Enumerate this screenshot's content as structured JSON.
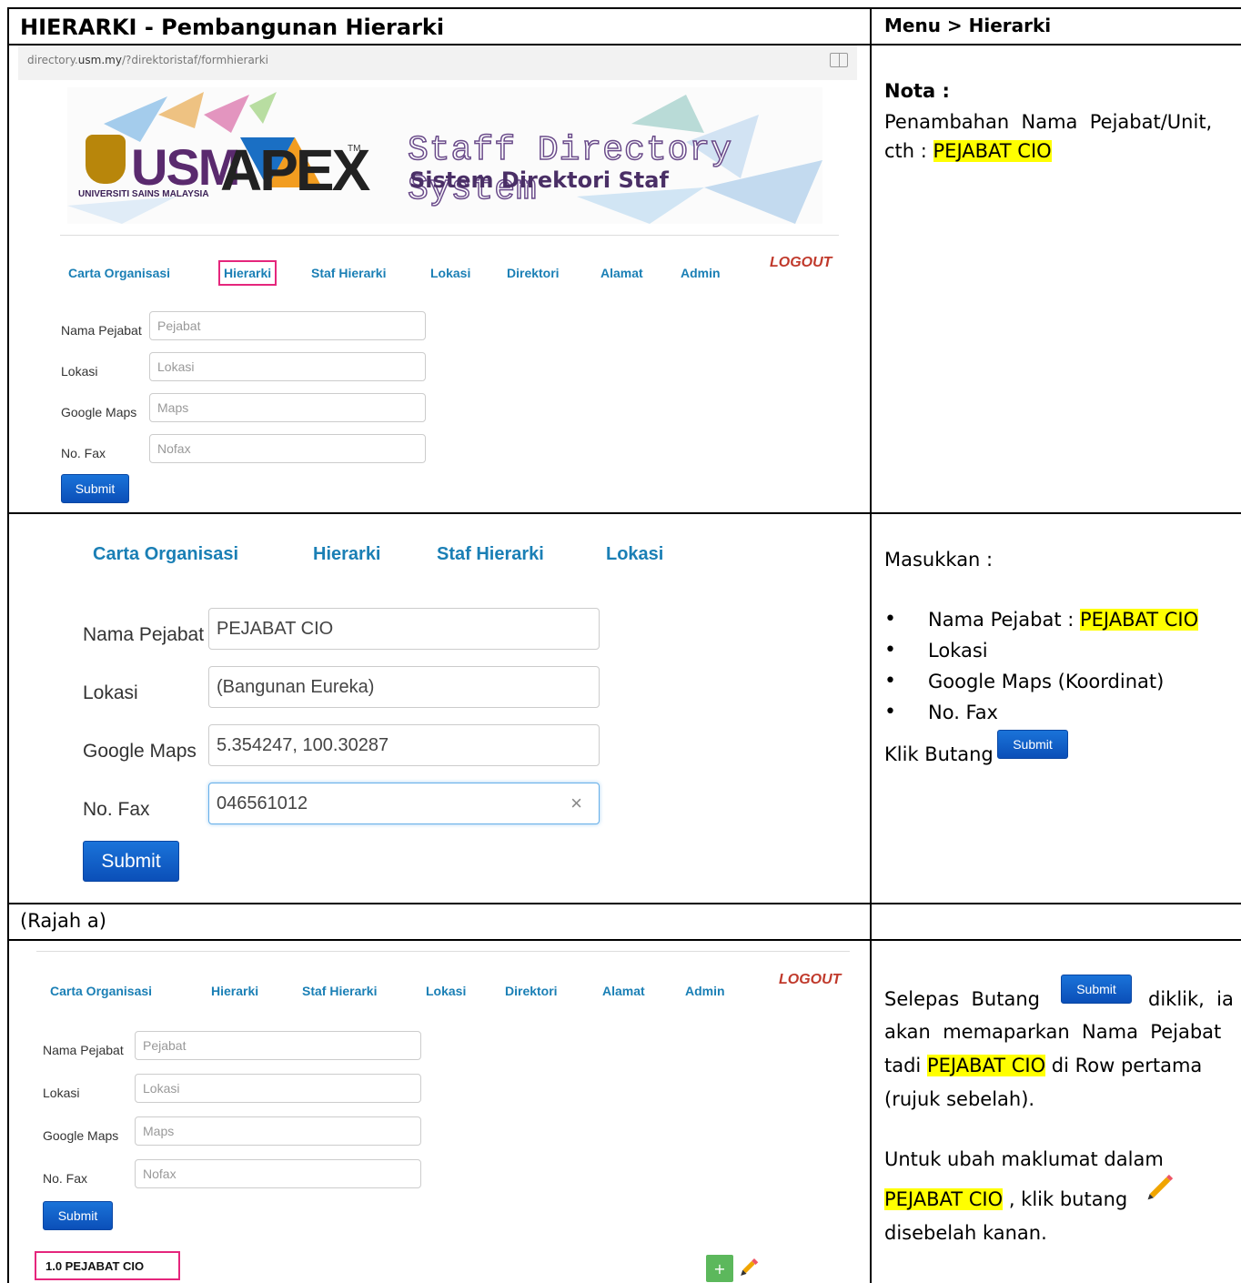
{
  "header": {
    "title": "HIERARKI - Pembangunan Hierarki",
    "menu_path": "Menu > Hierarki"
  },
  "browser": {
    "url_prefix": "directory.",
    "url_domain": "usm.my",
    "url_path": "/?direktoristaf/formhierarki"
  },
  "banner": {
    "usm": "USM",
    "university": "UNIVERSITI SAINS MALAYSIA",
    "apex": "APEX",
    "tm": "TM",
    "title_en": "Staff Directory System",
    "title_ms": "Sistem Direktori Staf"
  },
  "nav": {
    "items": [
      "Carta Organisasi",
      "Hierarki",
      "Staf Hierarki",
      "Lokasi",
      "Direktori",
      "Alamat",
      "Admin"
    ],
    "logout": "LOGOUT"
  },
  "form": {
    "labels": [
      "Nama Pejabat",
      "Lokasi",
      "Google Maps",
      "No. Fax"
    ],
    "placeholders": [
      "Pejabat",
      "Lokasi",
      "Maps",
      "Nofax"
    ],
    "submit": "Submit"
  },
  "filled_form": {
    "values": [
      "PEJABAT CIO",
      "(Bangunan Eureka)",
      "5.354247, 100.30287",
      "046561012"
    ],
    "clear_icon": "×"
  },
  "notes": {
    "nota_heading": "Nota :",
    "nota_line1": "Penambahan  Nama  Pejabat/Unit,",
    "nota_cth": "cth : ",
    "nota_value": "PEJABAT CIO",
    "masukkan": "Masukkan :",
    "bullet1_prefix": "Nama Pejabat : ",
    "bullet1_value": "PEJABAT CIO",
    "bullet2": "Lokasi",
    "bullet3": "Google Maps (Koordinat)",
    "bullet4": "No. Fax",
    "klik_butang": "Klik Butang",
    "caption": "(Rajah a)",
    "selepas_a": "Selepas  Butang",
    "selepas_b": "diklik,  ia",
    "line2": "akan  memaparkan  Nama  Pejabat",
    "line3_a": "tadi ",
    "line3_value": "PEJABAT CIO",
    "line3_b": " di Row pertama",
    "line4": "(rujuk sebelah).",
    "ubah_line": "Untuk ubah maklumat dalam",
    "ubah_value": "PEJABAT CIO",
    "ubah_b": " , klik butang",
    "disebelah": "disebelah kanan."
  },
  "result": {
    "row_label": "1.0 PEJABAT CIO",
    "plus": "+"
  },
  "colors": {
    "nav_link": "#1a7fb5",
    "highlight": "#ffff00",
    "annotation_box": "#e5267c",
    "button": "#0b4fb8",
    "add_button": "#5cb85c"
  }
}
